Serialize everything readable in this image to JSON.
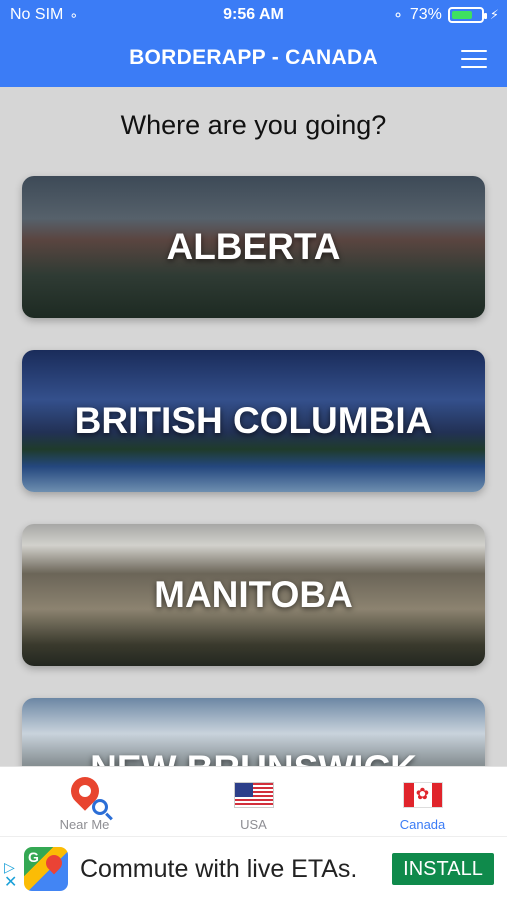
{
  "status_bar": {
    "carrier": "No SIM",
    "time": "9:56 AM",
    "battery_percent": "73%",
    "battery_level": 0.73,
    "battery_color": "#3ee061"
  },
  "nav": {
    "title": "BORDERAPP - CANADA",
    "menu_icon": "hamburger-icon",
    "bg_color": "#3b7cf6"
  },
  "main": {
    "heading": "Where are you going?",
    "provinces": [
      {
        "label": "ALBERTA"
      },
      {
        "label": "BRITISH COLUMBIA"
      },
      {
        "label": "MANITOBA"
      },
      {
        "label": "NEW BRUNSWICK"
      }
    ]
  },
  "tabs": [
    {
      "label": "Near Me",
      "icon": "map-pin-search-icon",
      "active": false
    },
    {
      "label": "USA",
      "icon": "us-flag-icon",
      "active": false
    },
    {
      "label": "Canada",
      "icon": "canada-flag-icon",
      "active": true
    }
  ],
  "ad": {
    "text": "Commute with live ETAs.",
    "cta": "INSTALL",
    "app_icon": "google-maps-icon"
  }
}
